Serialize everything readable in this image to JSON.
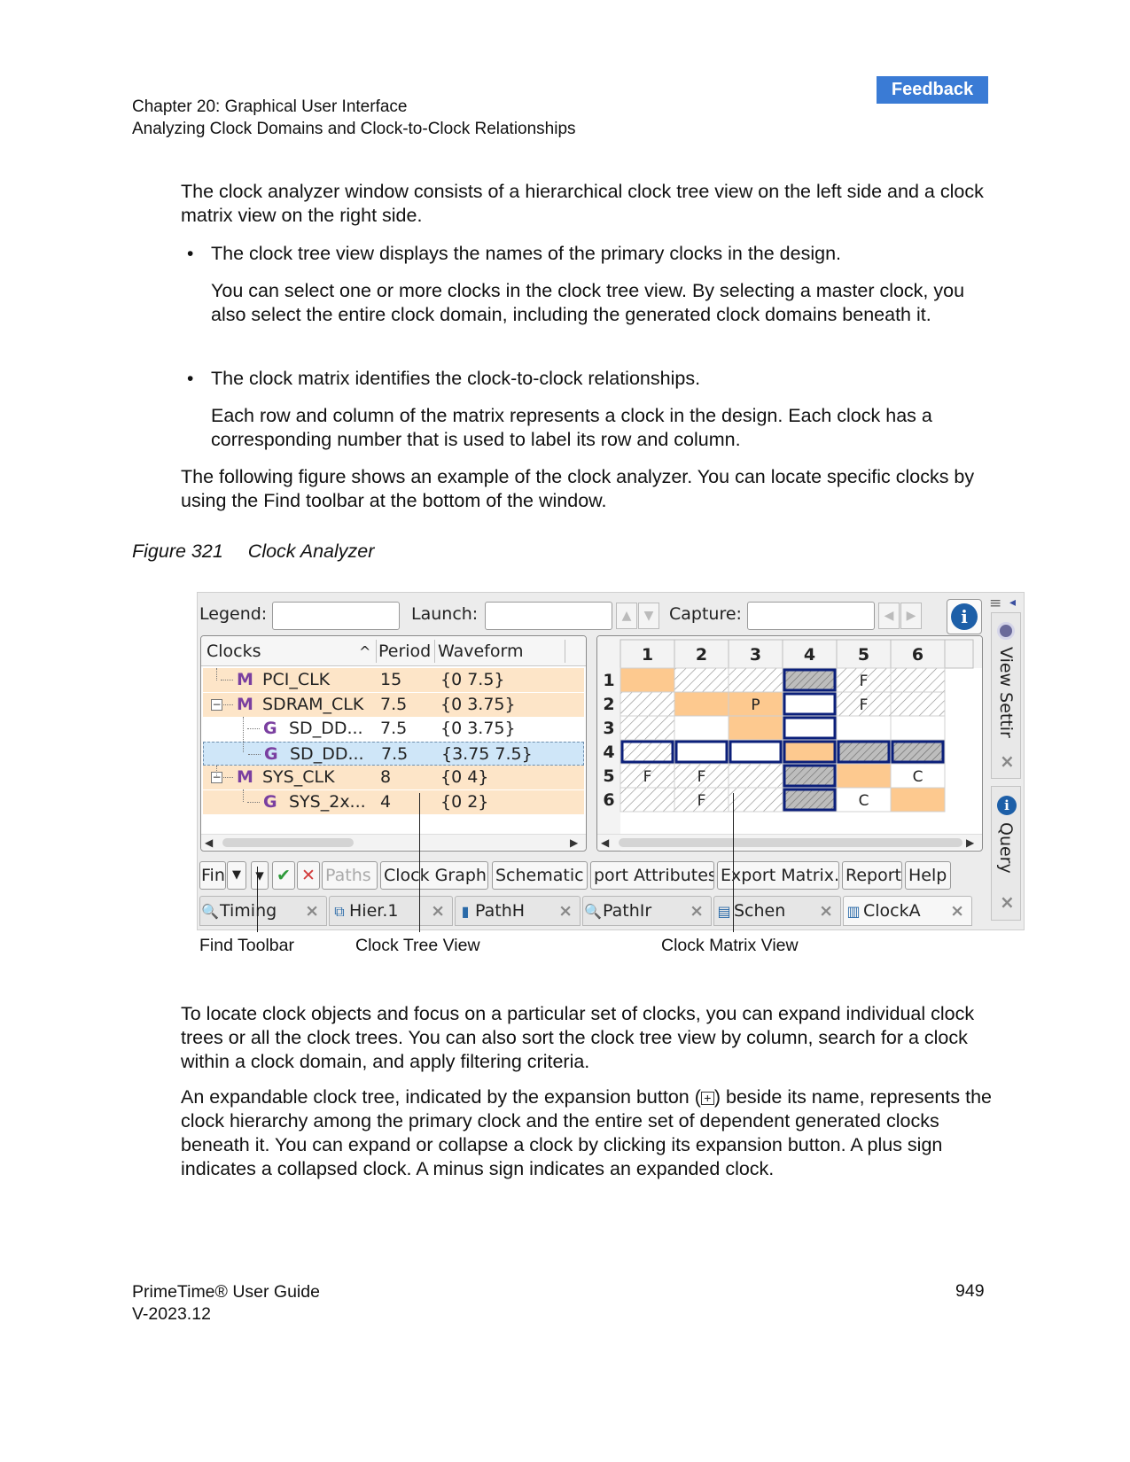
{
  "header": {
    "feedback": "Feedback",
    "chapter": "Chapter 20: Graphical User Interface",
    "section": "Analyzing Clock Domains and Clock-to-Clock Relationships"
  },
  "body": {
    "p1": "The clock analyzer window consists of a hierarchical clock tree view on the left side and a clock matrix view on the right side.",
    "bullet1": "The clock tree view displays the names of the primary clocks in the design.",
    "bullet1_sub": "You can select one or more clocks in the clock tree view. By selecting a master clock, you also select the entire clock domain, including the generated clock domains beneath it.",
    "bullet2": "The clock matrix identifies the clock-to-clock relationships.",
    "bullet2_sub": "Each row and column of the matrix represents a clock in the design. Each clock has a corresponding number that is used to label its row and column.",
    "p2": "The following figure shows an example of the clock analyzer. You can locate specific clocks by using the Find toolbar at the bottom of the window.",
    "p3": "To locate clock objects and focus on a particular set of clocks, you can expand individual clock trees or all the clock trees. You can also sort the clock tree view by column, search for a clock within a clock domain, and apply filtering criteria.",
    "p4_before": "An expandable clock tree, indicated by the expansion button (",
    "p4_after": ") beside its name, represents the clock hierarchy among the primary clock and the entire set of dependent generated clocks beneath it. You can expand or collapse a clock by clicking its expansion button. A plus sign indicates a collapsed clock. A minus sign indicates an expanded clock.",
    "plus_glyph": "+"
  },
  "bullet_glyph": "•",
  "figure": {
    "number": "Figure 321",
    "title": "Clock Analyzer"
  },
  "ui": {
    "legend_label": "Legend:",
    "launch_label": "Launch:",
    "capture_label": "Capture:",
    "up_glyph": "▲",
    "down_glyph": "▼",
    "left_glyph": "◀",
    "right_glyph": "▶",
    "info_glyph": "i",
    "tree": {
      "columns": [
        "Clocks",
        "Period",
        "Waveform"
      ],
      "sort_glyph": "^",
      "rows": [
        {
          "type": "M",
          "name": "PCI_CLK",
          "period": "15",
          "waveform": "{0 7.5}"
        },
        {
          "type": "M",
          "name": "SDRAM_CLK",
          "period": "7.5",
          "waveform": "{0 3.75}"
        },
        {
          "type": "G",
          "name": "SD_DD...",
          "period": "7.5",
          "waveform": "{0 3.75}"
        },
        {
          "type": "G",
          "name": "SD_DD...",
          "period": "7.5",
          "waveform": "{3.75 7.5}"
        },
        {
          "type": "M",
          "name": "SYS_CLK",
          "period": "8",
          "waveform": "{0 4}"
        },
        {
          "type": "G",
          "name": "SYS_2x...",
          "period": "4",
          "waveform": "{0 2}"
        }
      ],
      "collapse_glyph": "−"
    },
    "matrix": {
      "labels": [
        "1",
        "2",
        "3",
        "4",
        "5",
        "6"
      ],
      "cells": [
        [
          "orange",
          "hatch",
          "hatch",
          "hatchsel",
          "hatch:F",
          "hatch"
        ],
        [
          "hatch",
          "orange",
          "orange:P",
          "blank",
          "hatch:F",
          "hatch"
        ],
        [
          "hatch",
          "blank",
          "orange",
          "blank",
          "blank",
          "blank"
        ],
        [
          "hatch",
          "blank",
          "blank",
          "orange",
          "hatchsel",
          "hatchsel"
        ],
        [
          "hatch:F",
          "hatch:F",
          "hatch",
          "hatchsel",
          "orange",
          "blank:C"
        ],
        [
          "hatch",
          "hatch:F",
          "hatch",
          "hatchsel",
          "blank:C",
          "orange"
        ]
      ]
    },
    "find_toolbar": {
      "fin": "Fin",
      "dropdown": "▼",
      "caret": "▾",
      "ok_glyph": "✔",
      "cancel_glyph": "✕",
      "buttons": [
        "Paths",
        "Clock Graph",
        "Schematic",
        "port Attributes",
        "Export Matrix..",
        "Report",
        "Help"
      ]
    },
    "tabs": [
      {
        "icon": "🔍",
        "label": "Timing"
      },
      {
        "icon": "⧉",
        "label": "Hier.1"
      },
      {
        "icon": "▮",
        "label": "PathH"
      },
      {
        "icon": "🔍",
        "label": "PathIr"
      },
      {
        "icon": "▤",
        "label": "Schen"
      },
      {
        "icon": "▥",
        "label": "ClockA"
      }
    ],
    "tab_close": "×",
    "sidebar": {
      "view_settings": "View Settir",
      "query": "Query",
      "close": "×",
      "menu_glyph": "≡",
      "arrow_glyph": "◂"
    }
  },
  "callouts": [
    "Find Toolbar",
    "Clock Tree View",
    "Clock Matrix View"
  ],
  "footer": {
    "title": "PrimeTime® User Guide",
    "version": "V-2023.12",
    "page": "949"
  },
  "colors": {
    "accent": "#3a7bd5",
    "clock_row": "#fde5c8",
    "matrix_orange": "#fdc98f",
    "selection_border": "#0b1f7a",
    "selected_row": "#cfe6f8"
  }
}
